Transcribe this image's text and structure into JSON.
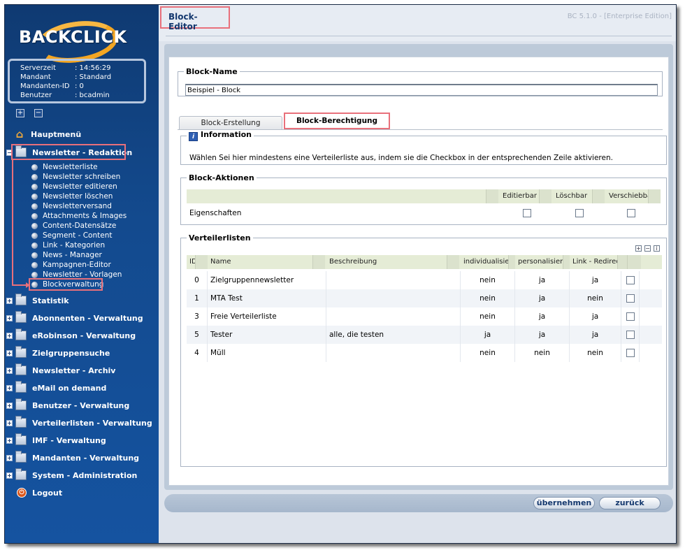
{
  "sidebar": {
    "logo_text": "BACKCLICK",
    "info": [
      {
        "key": "Serverzeit",
        "value": ": 14:56:29"
      },
      {
        "key": "Mandant",
        "value": ": Standard"
      },
      {
        "key": "Mandanten-ID",
        "value": ": 0"
      },
      {
        "key": "Benutzer",
        "value": ": bcadmin"
      }
    ],
    "expand_all": "+",
    "collapse_all": "−",
    "home": "Hauptmenü",
    "active_section": "Newsletter - Redaktion",
    "sub_items": [
      "Newsletterliste",
      "Newsletter schreiben",
      "Newsletter editieren",
      "Newsletter löschen",
      "Newsletterversand",
      "Attachments & Images",
      "Content-Datensätze",
      "Segment - Content",
      "Link - Kategorien",
      "News - Manager",
      "Kampagnen-Editor",
      "Newsletter - Vorlagen",
      "Blockverwaltung"
    ],
    "sections": [
      "Statistik",
      "Abonnenten - Verwaltung",
      "eRobinson - Verwaltung",
      "Zielgruppensuche",
      "Newsletter - Archiv",
      "eMail on demand",
      "Benutzer - Verwaltung",
      "Verteilerlisten - Verwaltung",
      "IMF - Verwaltung",
      "Mandanten - Verwaltung",
      "System - Administration"
    ],
    "logout": "Logout"
  },
  "header": {
    "title": "Block-Editor",
    "version": "BC 5.1.0 - [Enterprise Edition]"
  },
  "form": {
    "block_name_legend": "Block-Name",
    "block_name_value": "Beispiel - Block",
    "tabs": [
      "Block-Erstellung",
      "Block-Berechtigung"
    ],
    "info_legend": "Information",
    "info_text": "Wählen Sei hier mindestens eine Verteilerliste aus, indem sie die Checkbox in der entsprechenden Zeile aktivieren.",
    "actions_legend": "Block-Aktionen",
    "actions_headers": [
      "Editierbar",
      "Löschbar",
      "Verschiebbar"
    ],
    "actions_row_label": "Eigenschaften",
    "lists_legend": "Verteilerlisten",
    "lists_headers": [
      "ID",
      "Name",
      "Beschreibung",
      "individualisiert",
      "personalisiert",
      "Link - Redirect"
    ],
    "lists_rows": [
      {
        "id": "0",
        "name": "Zielgruppennewsletter",
        "desc": "",
        "ind": "nein",
        "pers": "ja",
        "link": "ja"
      },
      {
        "id": "1",
        "name": "MTA Test",
        "desc": "",
        "ind": "nein",
        "pers": "ja",
        "link": "nein"
      },
      {
        "id": "3",
        "name": "Freie Verteilerliste",
        "desc": "",
        "ind": "nein",
        "pers": "ja",
        "link": "ja"
      },
      {
        "id": "5",
        "name": "Tester",
        "desc": "alle, die testen",
        "ind": "ja",
        "pers": "ja",
        "link": "ja"
      },
      {
        "id": "4",
        "name": "Müll",
        "desc": "",
        "ind": "nein",
        "pers": "nein",
        "link": "nein"
      }
    ]
  },
  "buttons": {
    "apply": "übernehmen",
    "back": "zurück"
  }
}
